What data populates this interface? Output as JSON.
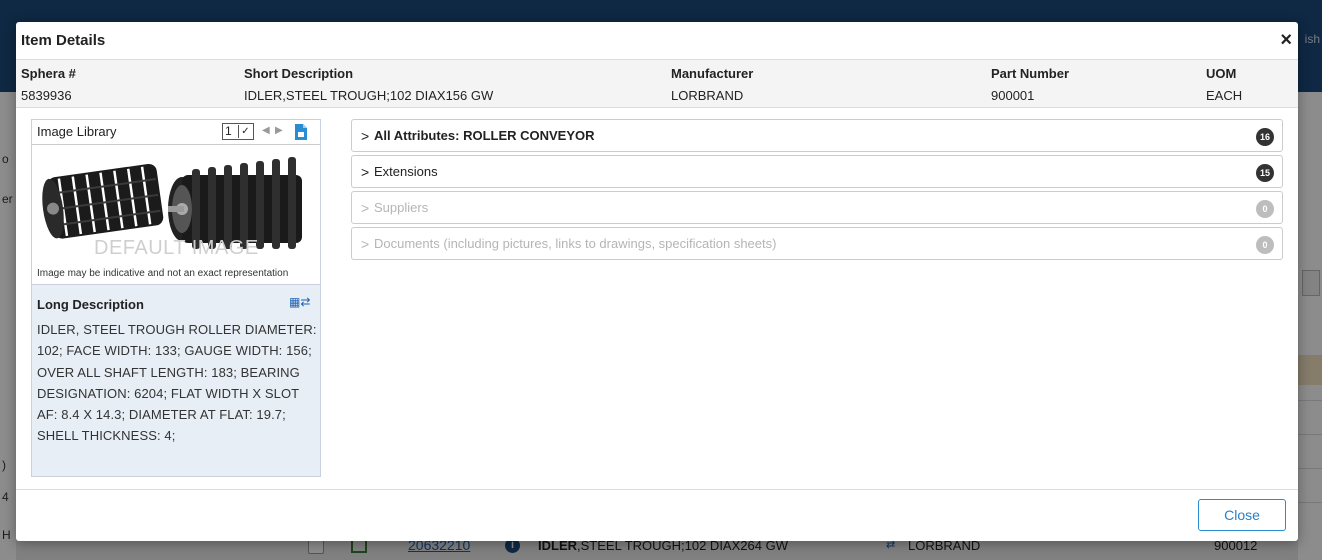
{
  "modal": {
    "title": "Item Details",
    "close_x": "×",
    "footer_close": "Close"
  },
  "summary": {
    "headers": [
      "Sphera #",
      "Short Description",
      "Manufacturer",
      "Part Number",
      "UOM"
    ],
    "values": [
      "5839936",
      "IDLER,STEEL TROUGH;102 DIAX156 GW",
      "LORBRAND",
      "900001",
      "EACH"
    ]
  },
  "image_library": {
    "label": "Image Library",
    "selected_index": "1",
    "watermark": "DEFAULT IMAGE",
    "note": "Image may be indicative and not an exact representation"
  },
  "long_description": {
    "heading": "Long Description",
    "text": "IDLER, STEEL TROUGH ROLLER DIAMETER: 102; FACE WIDTH: 133; GAUGE WIDTH: 156; OVER ALL SHAFT LENGTH: 183; BEARING DESIGNATION: 6204; FLAT WIDTH X SLOT AF: 8.4 X 14.3; DIAMETER AT FLAT: 19.7; SHELL THICKNESS: 4;"
  },
  "accordions": [
    {
      "label": "All Attributes: ROLLER CONVEYOR",
      "count": "16",
      "enabled": true
    },
    {
      "label": "Extensions",
      "count": "15",
      "enabled": true
    },
    {
      "label": "Suppliers",
      "count": "0",
      "enabled": false
    },
    {
      "label": "Documents (including pictures, links to drawings, specification sheets)",
      "count": "0",
      "enabled": false
    }
  ],
  "background": {
    "row_link": "20632210",
    "row_desc_bold": "IDLER",
    "row_desc_rest": ",STEEL TROUGH;102 DIAX264 GW",
    "row_manufacturer": "LORBRAND",
    "row_part_number": "900012"
  },
  "colors": {
    "accent": "#2a7fc4",
    "topbar": "#1d4a7a",
    "badge_active": "#333333",
    "badge_disabled": "#bdbdbd"
  }
}
